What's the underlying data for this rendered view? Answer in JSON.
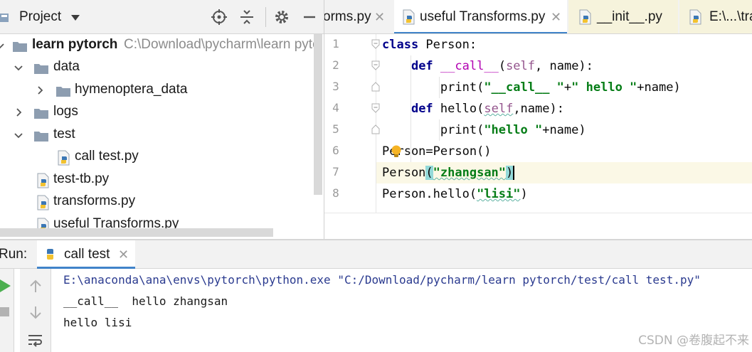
{
  "project_panel": {
    "title": "Project",
    "tree": [
      {
        "label": "learn pytorch",
        "path": "C:\\Download\\pycharm\\learn pyto",
        "kind": "root"
      },
      {
        "label": "data",
        "kind": "folder",
        "expanded": true
      },
      {
        "label": "hymenoptera_data",
        "kind": "folder",
        "expanded": false
      },
      {
        "label": "logs",
        "kind": "folder",
        "expanded": false
      },
      {
        "label": "test",
        "kind": "folder",
        "expanded": true
      },
      {
        "label": "call test.py",
        "kind": "python-file"
      },
      {
        "label": "test-tb.py",
        "kind": "python-file"
      },
      {
        "label": "transforms.py",
        "kind": "python-file"
      },
      {
        "label": "useful Transforms.py",
        "kind": "python-file"
      }
    ]
  },
  "editor_tabs": [
    {
      "label": "orms.py",
      "active": false
    },
    {
      "label": "useful Transforms.py",
      "active": true
    },
    {
      "label": "__init__.py",
      "active": false
    },
    {
      "label": "E:\\...\\tra",
      "active": false
    }
  ],
  "editor": {
    "line_numbers": [
      "1",
      "2",
      "3",
      "4",
      "5",
      "6",
      "7",
      "8"
    ],
    "lines": {
      "l1": {
        "kw": "class",
        "rest": " Person:"
      },
      "l2": {
        "kw": "def",
        "name": "__call__",
        "open": "(",
        "self": "self",
        "rest": ", name):"
      },
      "l3": {
        "call": "print(",
        "s1": "\"__call__ \"",
        "plus": "+",
        "s2": "\" hello \"",
        "rest": "+name)"
      },
      "l4": {
        "kw": "def",
        "name": "hello",
        "open": "(",
        "self": "self",
        "rest": ",name):"
      },
      "l5": {
        "call": "print(",
        "s1": "\"hello \"",
        "rest": "+name)"
      },
      "l6": {
        "text": "Person=Person()"
      },
      "l7": {
        "fn": "Person",
        "open": "(",
        "str": "\"zhangsan\"",
        "close": ")"
      },
      "l8": {
        "fn": "Person.hello(",
        "str": "\"lisi\"",
        "close": ")"
      }
    }
  },
  "run_panel": {
    "label": "Run:",
    "tab_label": "call test",
    "console": [
      "E:\\anaconda\\ana\\envs\\pytorch\\python.exe \"C:/Download/pycharm/learn pytorch/test/call test.py\"",
      "__call__  hello zhangsan",
      "hello lisi"
    ]
  },
  "watermark": "CSDN @卷腹起不来",
  "colors": {
    "accent": "#4083c9",
    "keyword": "#00008b",
    "string": "#067d17",
    "self_param": "#94558d",
    "dunder": "#b200b2",
    "current_line": "#fbf8e6",
    "run_green": "#4caf50"
  }
}
